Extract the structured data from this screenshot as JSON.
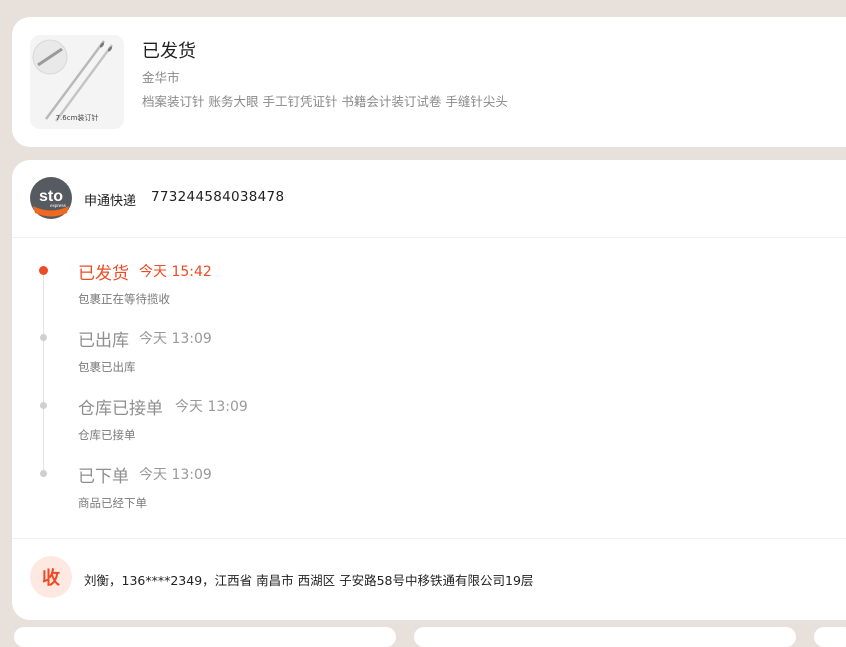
{
  "product": {
    "status": "已发货",
    "city": "金华市",
    "title": "档案装订针 账务大眼 手工钉凭证针 书籍会计装订试卷 手缝针尖头",
    "thumb_caption": "7.6cm装订针"
  },
  "shipment": {
    "logo_text": "sto",
    "logo_subtext": "express",
    "carrier": "申通快递",
    "tracking_number": "773244584038478"
  },
  "timeline": [
    {
      "title": "已发货",
      "time": "今天 15:42",
      "desc": "包裹正在等待揽收",
      "active": true
    },
    {
      "title": "已出库",
      "time": "今天 13:09",
      "desc": "包裹已出库",
      "active": false
    },
    {
      "title": "仓库已接单",
      "time": "今天 13:09",
      "desc": "仓库已接单",
      "active": false
    },
    {
      "title": "已下单",
      "time": "今天 13:09",
      "desc": "商品已经下单",
      "active": false
    }
  ],
  "receiver": {
    "icon_label": "收",
    "text": "刘衡，136****2349，江西省 南昌市 西湖区 子安路58号中移铁通有限公司19层"
  },
  "colors": {
    "accent": "#f04a24",
    "background": "#e8e0da",
    "sto_orange": "#ef6a1f",
    "sto_gray": "#555b60"
  }
}
